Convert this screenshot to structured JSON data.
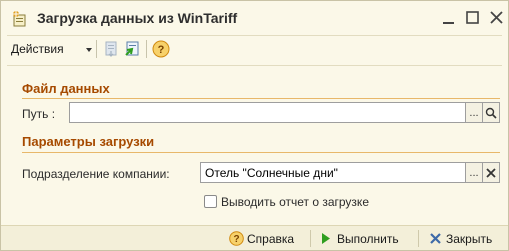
{
  "window": {
    "title": "Загрузка данных из WinTariff",
    "min_glyph": "_",
    "max_glyph": "□",
    "close_glyph": "✕"
  },
  "toolbar": {
    "actions_label": "Действия",
    "help_glyph": "?"
  },
  "sections": {
    "data_file": {
      "title": "Файл данных",
      "path_label": "Путь :",
      "path_value": "",
      "select_glyph": "...",
      "open_glyph": "🔍"
    },
    "load_params": {
      "title": "Параметры загрузки",
      "division_label": "Подразделение компании:",
      "division_value": "Отель \"Солнечные дни\"",
      "select_glyph": "...",
      "clear_glyph": "✕",
      "report_checkbox_label": "Выводить отчет о загрузке",
      "report_checked": false
    }
  },
  "bottom": {
    "help_label": "Справка",
    "run_label": "Выполнить",
    "close_label": "Закрыть"
  },
  "colors": {
    "background": "#fbf8e8",
    "section_title": "#a64a00",
    "accent_green": "#2f9e1f",
    "help_orange": "#f0a020"
  }
}
